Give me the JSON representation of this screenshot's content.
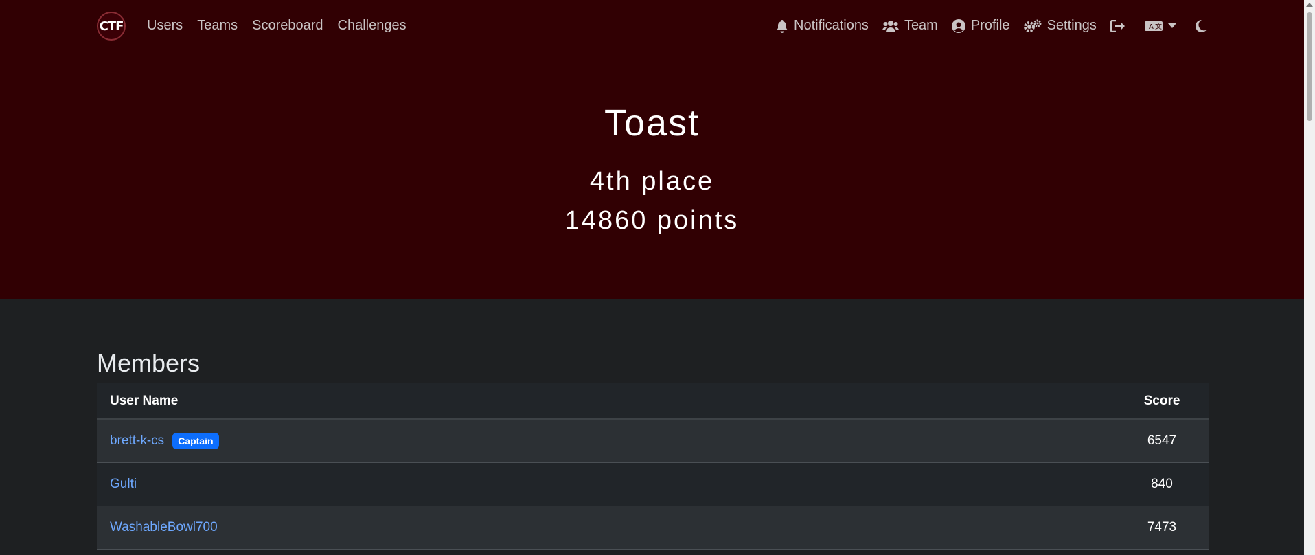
{
  "nav": {
    "logo_text": "CTF",
    "left": [
      "Users",
      "Teams",
      "Scoreboard",
      "Challenges"
    ],
    "notifications": "Notifications",
    "team": "Team",
    "profile": "Profile",
    "settings": "Settings"
  },
  "hero": {
    "team_name": "Toast",
    "place": "4th place",
    "points": "14860 points"
  },
  "members": {
    "heading": "Members",
    "columns": [
      "User Name",
      "Score"
    ],
    "rows": [
      {
        "name": "brett-k-cs",
        "badge": "Captain",
        "score": "6547"
      },
      {
        "name": "Gulti",
        "score": "840"
      },
      {
        "name": "WashableBowl700",
        "score": "7473"
      }
    ]
  },
  "colors": {
    "hero_bg": "#310003",
    "page_bg": "#1e2022",
    "link": "#6ea8fe",
    "badge": "#0d6efd"
  }
}
